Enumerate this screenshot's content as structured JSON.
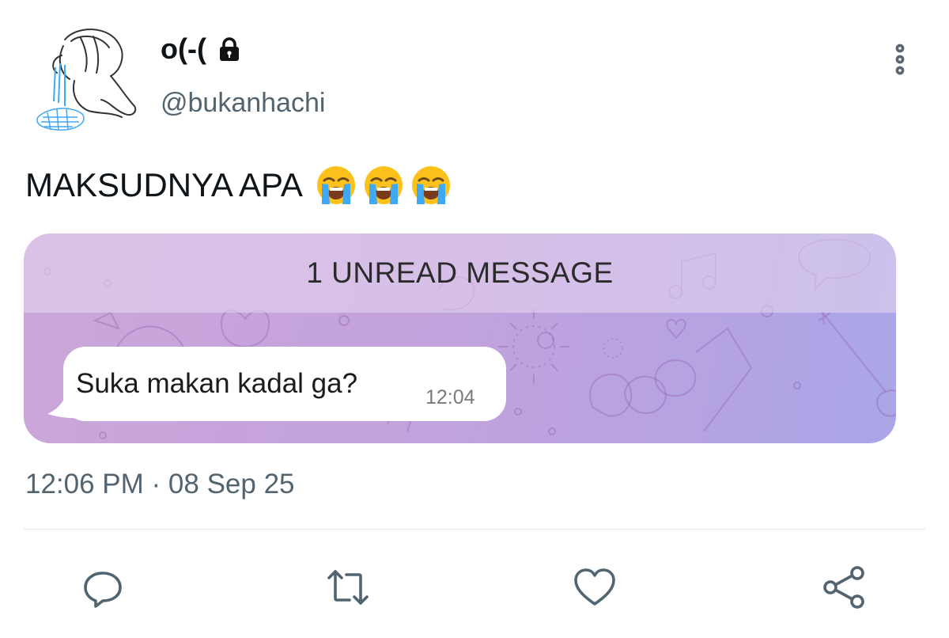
{
  "tweet": {
    "display_name": "o(-(",
    "handle": "@bukanhachi",
    "text": "MAKSUDNYA APA",
    "timestamp": "12:06 PM · 08 Sep 25",
    "emojis": [
      "loudly-crying-face",
      "loudly-crying-face",
      "loudly-crying-face"
    ]
  },
  "media": {
    "unread_label": "1 UNREAD MESSAGE",
    "message_text": "Suka makan kadal ga?",
    "message_time": "12:04"
  },
  "icons": {
    "lock": "lock-icon",
    "more": "more-vertical-icon",
    "reply": "reply-icon",
    "retweet": "retweet-icon",
    "like": "heart-icon",
    "share": "share-icon"
  },
  "colors": {
    "secondary_text": "#536471",
    "media_gradient_start": "#cba7da",
    "media_gradient_end": "#a9a6e8",
    "emoji_yellow": "#fcc21b",
    "tear_blue": "#3fa9f5"
  }
}
